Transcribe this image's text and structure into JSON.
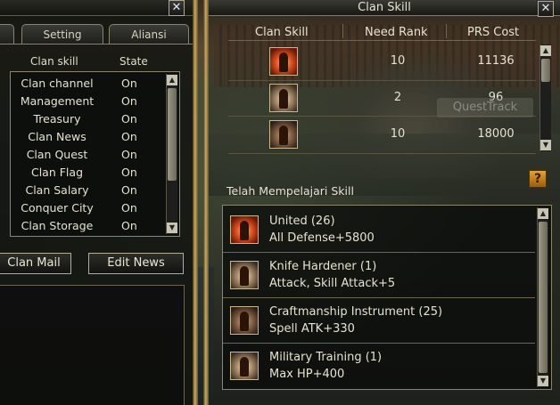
{
  "left_window": {
    "tabs": [
      {
        "label": "Setting"
      },
      {
        "label": "Aliansi"
      }
    ],
    "columns": {
      "name": "Clan skill",
      "state": "State"
    },
    "settings": [
      {
        "name": "Clan channel",
        "state": "On"
      },
      {
        "name": "Management",
        "state": "On"
      },
      {
        "name": "Treasury",
        "state": "On"
      },
      {
        "name": "Clan News",
        "state": "On"
      },
      {
        "name": "Clan Quest",
        "state": "On"
      },
      {
        "name": "Clan Flag",
        "state": "On"
      },
      {
        "name": "Clan Salary",
        "state": "On"
      },
      {
        "name": "Conquer City",
        "state": "On"
      },
      {
        "name": "Clan Storage",
        "state": "On"
      }
    ],
    "buttons": {
      "clan_mail": "Clan Mail",
      "edit_news": "Edit News"
    }
  },
  "skill_window": {
    "title": "Clan Skill",
    "columns": {
      "skill": "Clan Skill",
      "rank": "Need Rank",
      "cost": "PRS Cost"
    },
    "skills": [
      {
        "icon": "fire-warrior-icon",
        "rank": "10",
        "cost": "11136"
      },
      {
        "icon": "crossed-blades-icon",
        "rank": "2",
        "cost": "96"
      },
      {
        "icon": "armored-warrior-icon",
        "rank": "10",
        "cost": "18000"
      }
    ],
    "watermark": "QuestTrack",
    "help_label": "?",
    "learned_title": "Telah Mempelajari Skill",
    "learned": [
      {
        "icon": "fire-warrior-icon",
        "name": "United (26)",
        "effect": "All Defense+5800"
      },
      {
        "icon": "crossed-blades-icon",
        "name": "Knife Hardener (1)",
        "effect": "Attack, Skill Attack+5"
      },
      {
        "icon": "armored-warrior-icon",
        "name": "Craftmanship Instrument (25)",
        "effect": "Spell ATK+330"
      },
      {
        "icon": "soldier-icon",
        "name": "Military Training (1)",
        "effect": "Max HP+400"
      }
    ]
  },
  "icons": {
    "close": "close-icon",
    "scroll_up": "arrow-up-icon",
    "scroll_down": "arrow-down-icon"
  },
  "colors": {
    "gold_border": "#c8aa60",
    "text": "#e8e2d0",
    "help_orange": "#e8a428"
  }
}
